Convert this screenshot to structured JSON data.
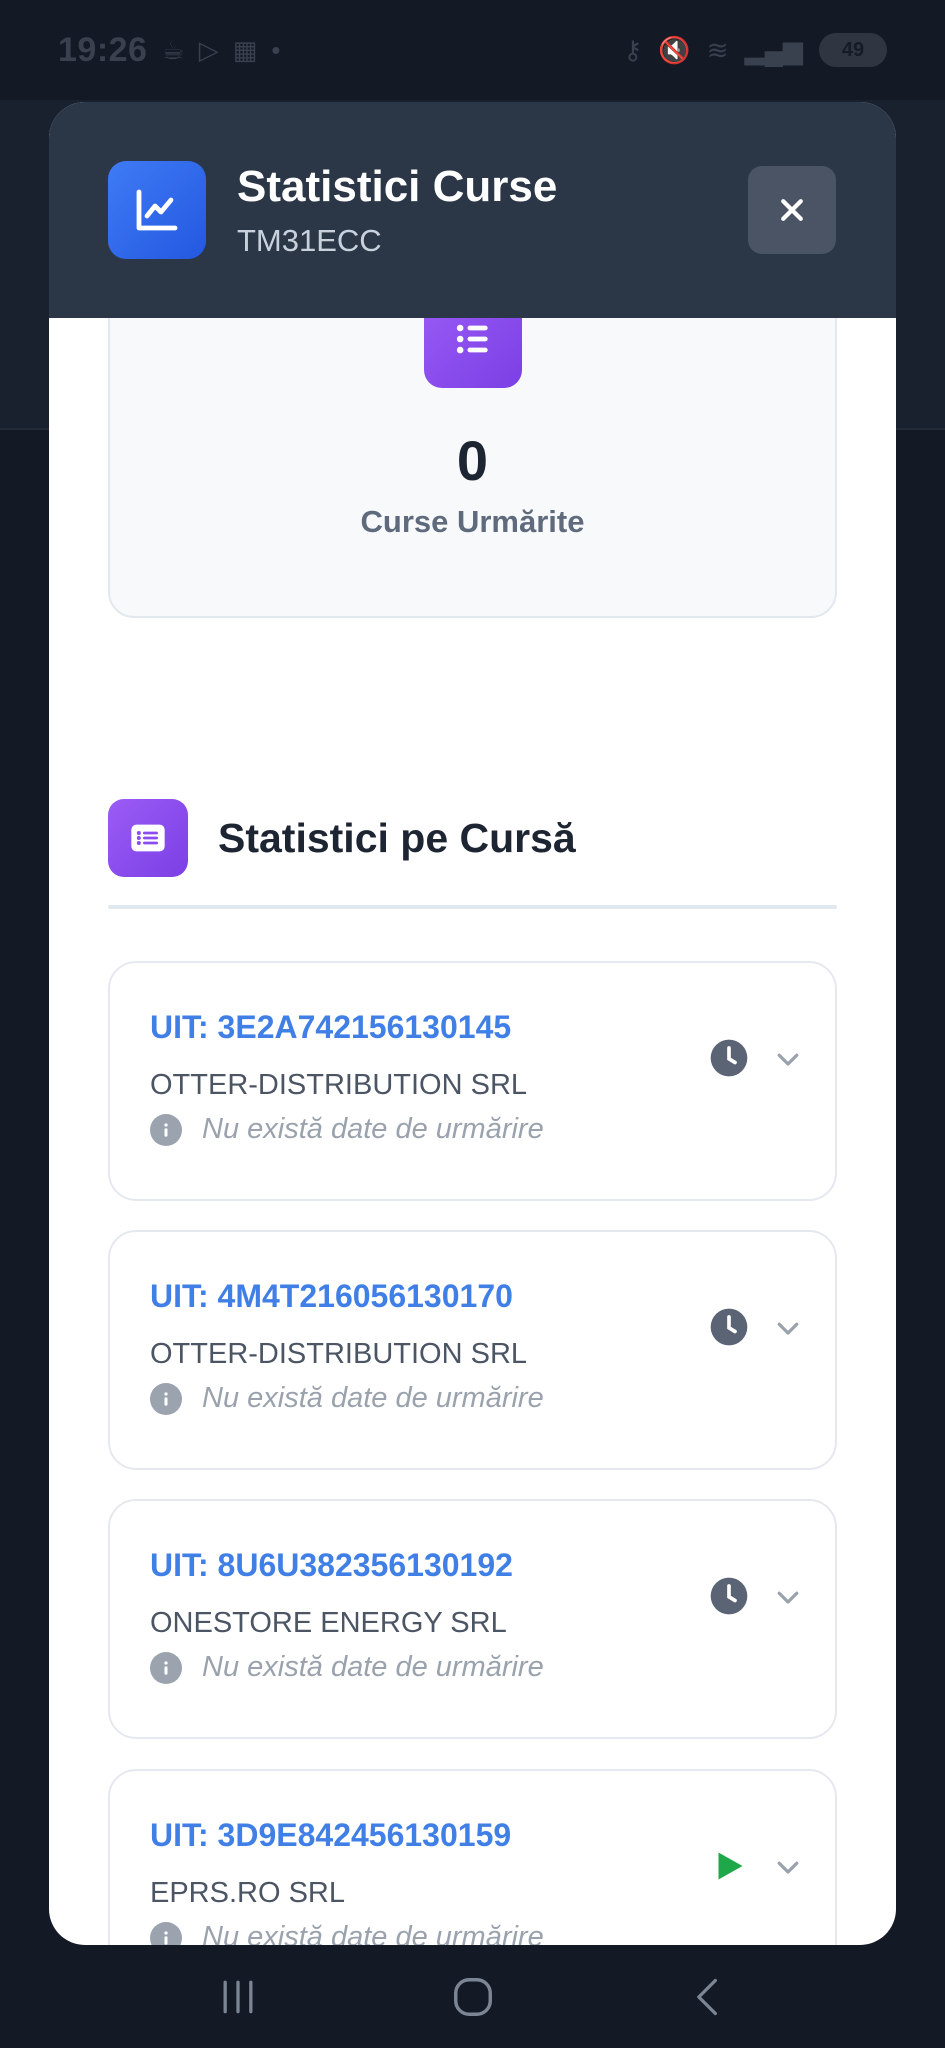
{
  "status_bar": {
    "time": "19:26",
    "battery": "49"
  },
  "modal": {
    "title": "Statistici Curse",
    "subtitle": "TM31ECC",
    "icon": "chart-line-icon",
    "close_icon": "close-icon"
  },
  "summary": {
    "value": "0",
    "label": "Curse Urmărite",
    "icon": "list-icon"
  },
  "section": {
    "title": "Statistici pe Cursă",
    "icon": "list-icon"
  },
  "trips": [
    {
      "uit": "UIT: 3E2A742156130145",
      "company": "OTTER-DISTRIBUTION SRL",
      "note": "Nu există date de urmărire",
      "status": "clock-icon"
    },
    {
      "uit": "UIT: 4M4T216056130170",
      "company": "OTTER-DISTRIBUTION SRL",
      "note": "Nu există date de urmărire",
      "status": "clock-icon"
    },
    {
      "uit": "UIT: 8U6U382356130192",
      "company": "ONESTORE ENERGY SRL",
      "note": "Nu există date de urmărire",
      "status": "clock-icon"
    },
    {
      "uit": "UIT: 3D9E842456130159",
      "company": "EPRS.RO SRL",
      "note": "Nu există date de urmărire",
      "status": "play-icon"
    }
  ],
  "colors": {
    "header_bg": "#2b3647",
    "accent_blue": "#3f7fe6",
    "accent_purple": "#8b4cf0",
    "status_clock": "#5b6474",
    "status_play": "#1fa84a"
  }
}
